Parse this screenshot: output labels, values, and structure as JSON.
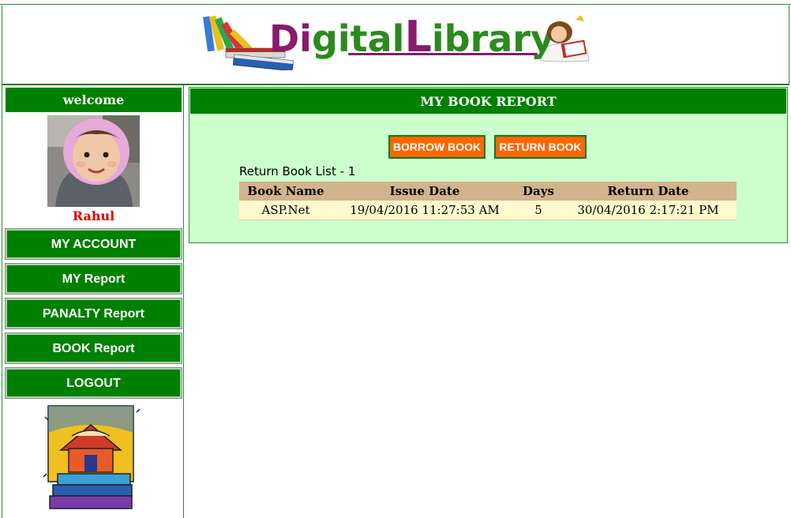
{
  "header": {
    "logo_text": {
      "part1": "Di",
      "part2": "gital",
      "part3": "L",
      "part4": "ibrary"
    }
  },
  "sidebar": {
    "welcome": "welcome",
    "username": "Rahul",
    "nav": [
      {
        "label": "MY ACCOUNT"
      },
      {
        "label": "MY Report"
      },
      {
        "label": "PANALTY Report"
      },
      {
        "label": "BOOK Report"
      },
      {
        "label": "LOGOUT"
      }
    ]
  },
  "main": {
    "title": "MY BOOK REPORT",
    "borrow_label": "BORROW BOOK",
    "return_label": "RETURN BOOK",
    "list_title": "Return Book List - 1",
    "table": {
      "headers": [
        "Book Name",
        "Issue Date",
        "Days",
        "Return Date"
      ],
      "rows": [
        [
          "ASP.Net",
          "19/04/2016 11:27:53 AM",
          "5",
          "30/04/2016 2:17:21 PM"
        ]
      ]
    }
  },
  "colors": {
    "primary_green": "#008000",
    "panel_bg": "#ccffcc",
    "action_orange": "#ff6600",
    "table_header": "#d2b48c",
    "table_row": "#fffacd",
    "username_red": "#e10000"
  }
}
